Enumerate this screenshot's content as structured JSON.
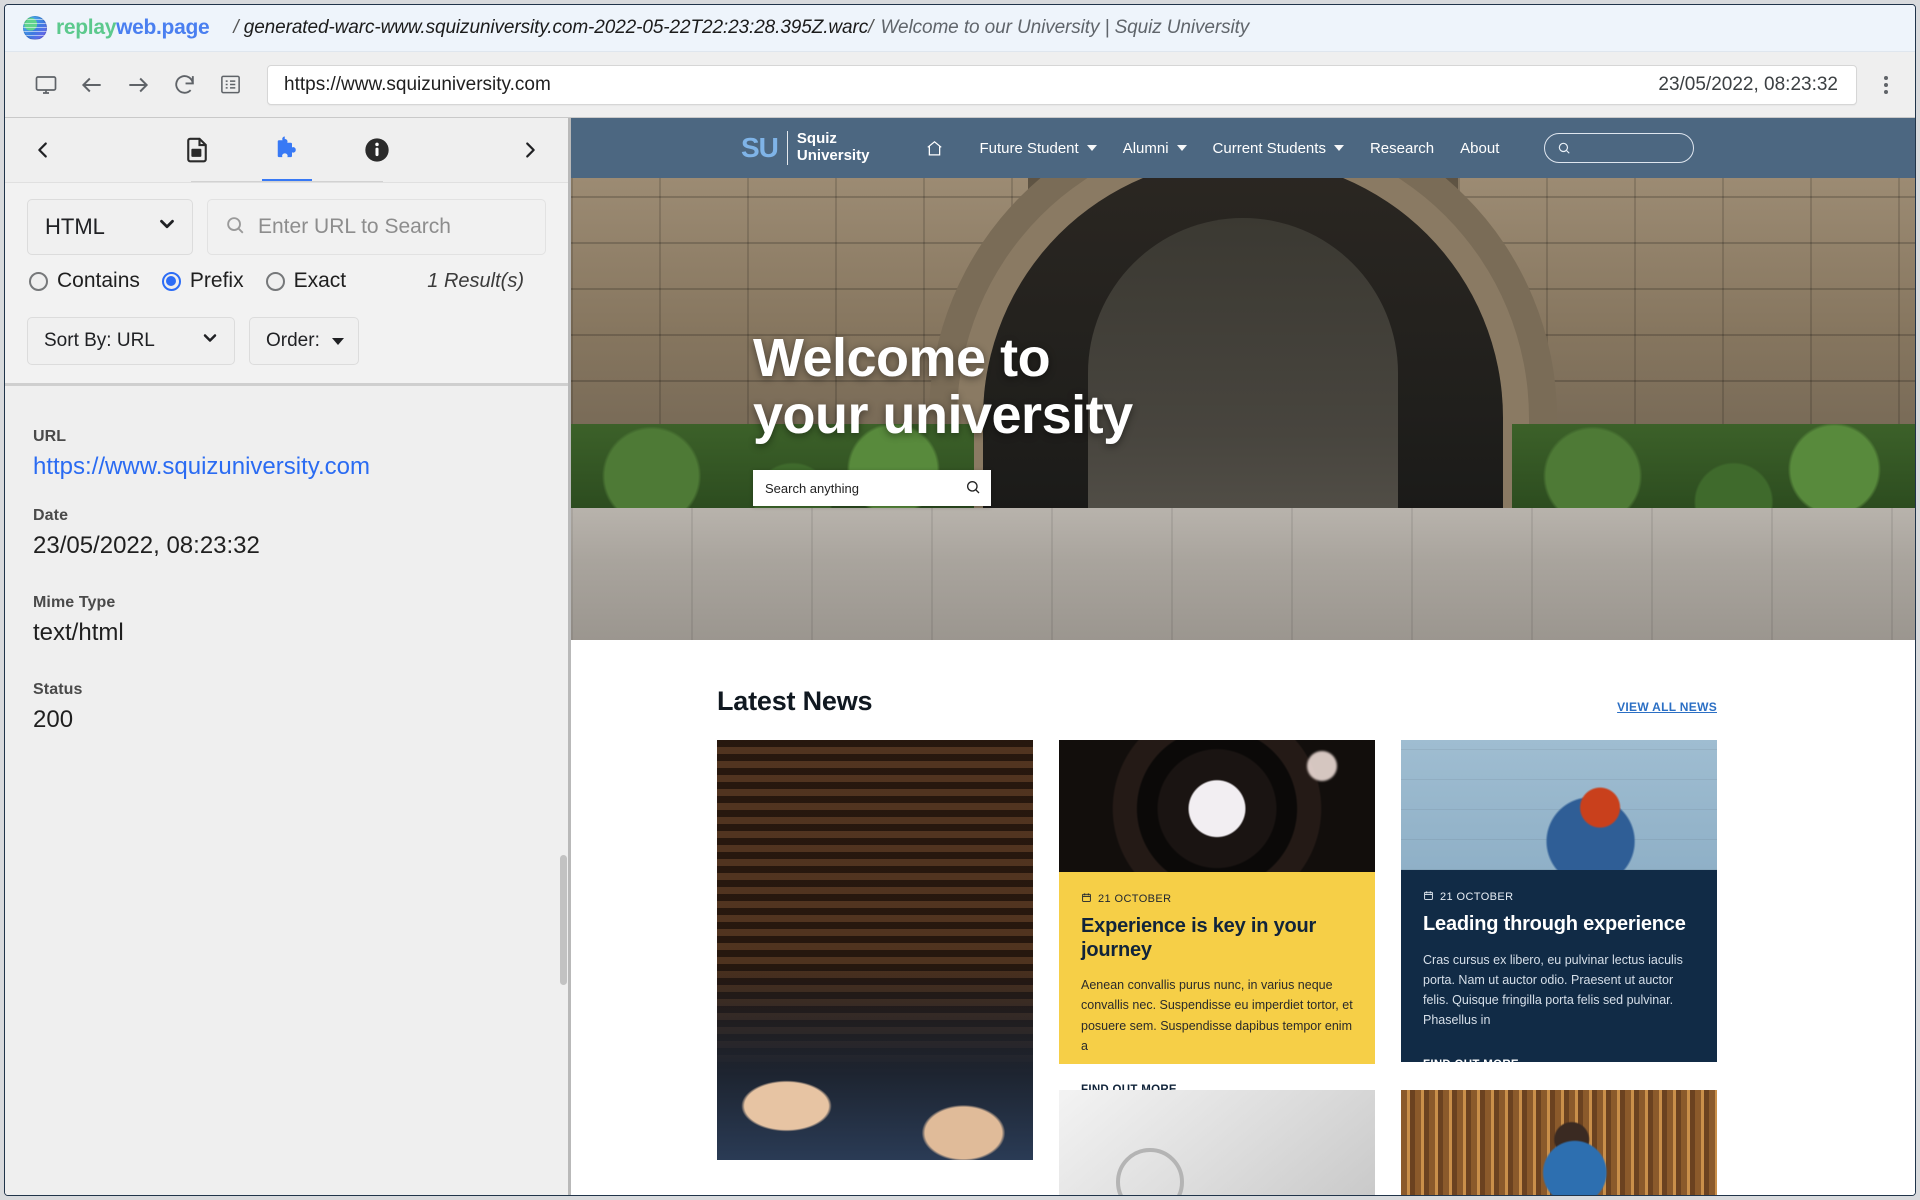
{
  "titlebar": {
    "brand_replay": "replay",
    "brand_webpage": "web.page",
    "separator_left": "/",
    "warc_name": "generated-warc-www.squizuniversity.com-2022-05-22T22:23:28.395Z.warc",
    "separator_right": "/",
    "page_title": "Welcome to our University | Squiz University"
  },
  "chrome": {
    "icons": [
      "screen-icon",
      "back-arrow-icon",
      "forward-arrow-icon",
      "reload-icon",
      "list-icon"
    ],
    "url_value": "https://www.squizuniversity.com",
    "url_placeholder": "https://www.squizuniversity.com",
    "timestamp": "23/05/2022, 08:23:32",
    "menu_label": "kebab-menu"
  },
  "sidebar": {
    "prev_label": "‹",
    "next_label": "›",
    "tabs": [
      {
        "name": "resources-tab",
        "icon": "image-file-icon",
        "active": false
      },
      {
        "name": "extract-tab",
        "icon": "puzzle-piece-icon",
        "active": true
      },
      {
        "name": "info-tab",
        "icon": "info-circle-icon",
        "active": false
      }
    ],
    "filter": {
      "type_value": "HTML",
      "search_placeholder": "Enter URL to Search",
      "search_value": "",
      "match_modes": [
        {
          "label": "Contains",
          "selected": false
        },
        {
          "label": "Prefix",
          "selected": true
        },
        {
          "label": "Exact",
          "selected": false
        }
      ],
      "result_count": "1 Result(s)"
    },
    "sort": {
      "sort_by_label": "Sort By: URL",
      "order_label": "Order:"
    },
    "detail": [
      {
        "key": "URL",
        "value": "https://www.squizuniversity.com",
        "is_link": true
      },
      {
        "key": "Date",
        "value": "23/05/2022, 08:23:32",
        "is_link": false
      },
      {
        "key": "Mime Type",
        "value": "text/html",
        "is_link": false
      },
      {
        "key": "Status",
        "value": "200",
        "is_link": false
      }
    ]
  },
  "site": {
    "nav": {
      "logo_mark": "SU",
      "logo_line1": "Squiz",
      "logo_line2": "University",
      "home_icon": "home-icon",
      "items": [
        {
          "label": "Future Student",
          "has_dropdown": true
        },
        {
          "label": "Alumni",
          "has_dropdown": true
        },
        {
          "label": "Current Students",
          "has_dropdown": true
        },
        {
          "label": "Research",
          "has_dropdown": false
        },
        {
          "label": "About",
          "has_dropdown": false
        }
      ],
      "search_placeholder": "",
      "bg_color": "#4c6781"
    },
    "hero": {
      "heading_line1": "Welcome to",
      "heading_line2": "your university",
      "search_placeholder": "Search anything",
      "search_icon": "search-icon"
    },
    "news": {
      "section_title": "Latest News",
      "view_all_label": "VIEW ALL NEWS",
      "cards": [
        {
          "name": "news-card-people",
          "image": "two-students-with-phone-photo",
          "theme": "image-only"
        },
        {
          "name": "news-card-experience",
          "image": "camera-lens-photo",
          "theme": "yellow",
          "date_icon": "calendar-icon",
          "date": "21 OCTOBER",
          "title": "Experience is key in your journey",
          "excerpt": "Aenean convallis purus nunc, in varius neque convallis nec. Suspendisse eu imperdiet tortor, et posuere sem. Suspendisse dapibus tempor enim a",
          "cta": "FIND OUT MORE",
          "bg_color": "#f6cf47"
        },
        {
          "name": "news-card-leading",
          "image": "woman-pointing-photo",
          "theme": "navy",
          "date_icon": "calendar-icon",
          "date": "21 OCTOBER",
          "title": "Leading through experience",
          "excerpt": "Cras cursus ex libero, eu pulvinar lectus iaculis porta. Nam ut auctor odio. Praesent ut auctor felis. Quisque fringilla porta felis sed pulvinar. Phasellus in",
          "cta": "FIND OUT MORE",
          "bg_color": "#112b46"
        },
        {
          "name": "news-card-white",
          "image": "white-abstract-photo",
          "theme": "image-only"
        },
        {
          "name": "news-card-library",
          "image": "student-in-library-photo",
          "theme": "image-only"
        }
      ]
    }
  }
}
